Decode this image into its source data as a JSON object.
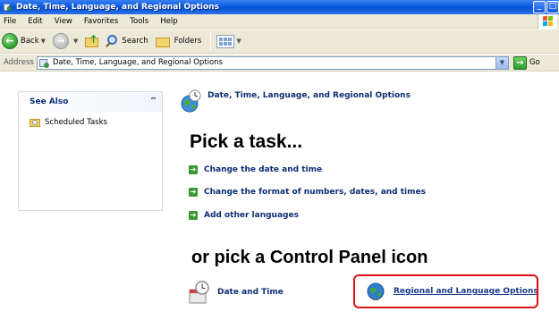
{
  "window": {
    "title": "Date, Time, Language, and Regional Options",
    "buttons": [
      "_",
      "□",
      "×"
    ]
  },
  "menu": {
    "items": [
      "File",
      "Edit",
      "View",
      "Favorites",
      "Tools",
      "Help"
    ]
  },
  "toolbar": {
    "back_label": "Back",
    "search_label": "Search",
    "folders_label": "Folders"
  },
  "address": {
    "label": "Address",
    "value": "Date, Time, Language, and Regional Options",
    "go_label": "Go"
  },
  "see_also": {
    "title": "See Also",
    "items": [
      {
        "label": "Scheduled Tasks",
        "icon": "scheduled-tasks-icon"
      }
    ]
  },
  "main": {
    "category_title": "Date, Time, Language, and Regional Options",
    "pick_task": "Pick a task...",
    "tasks": [
      "Change the date and time",
      "Change the format of numbers, dates, and times",
      "Add other languages"
    ],
    "pick_icon": "or pick a Control Panel icon",
    "icons": [
      {
        "label": "Date and Time",
        "icon": "date-time-icon"
      },
      {
        "label": "Regional and Language Options",
        "icon": "globe-icon"
      }
    ]
  },
  "colors": {
    "titlebar": "#0a5be0",
    "link": "#0c2e74",
    "task_arrow": "#3a9a32",
    "highlight": "#e01010"
  }
}
